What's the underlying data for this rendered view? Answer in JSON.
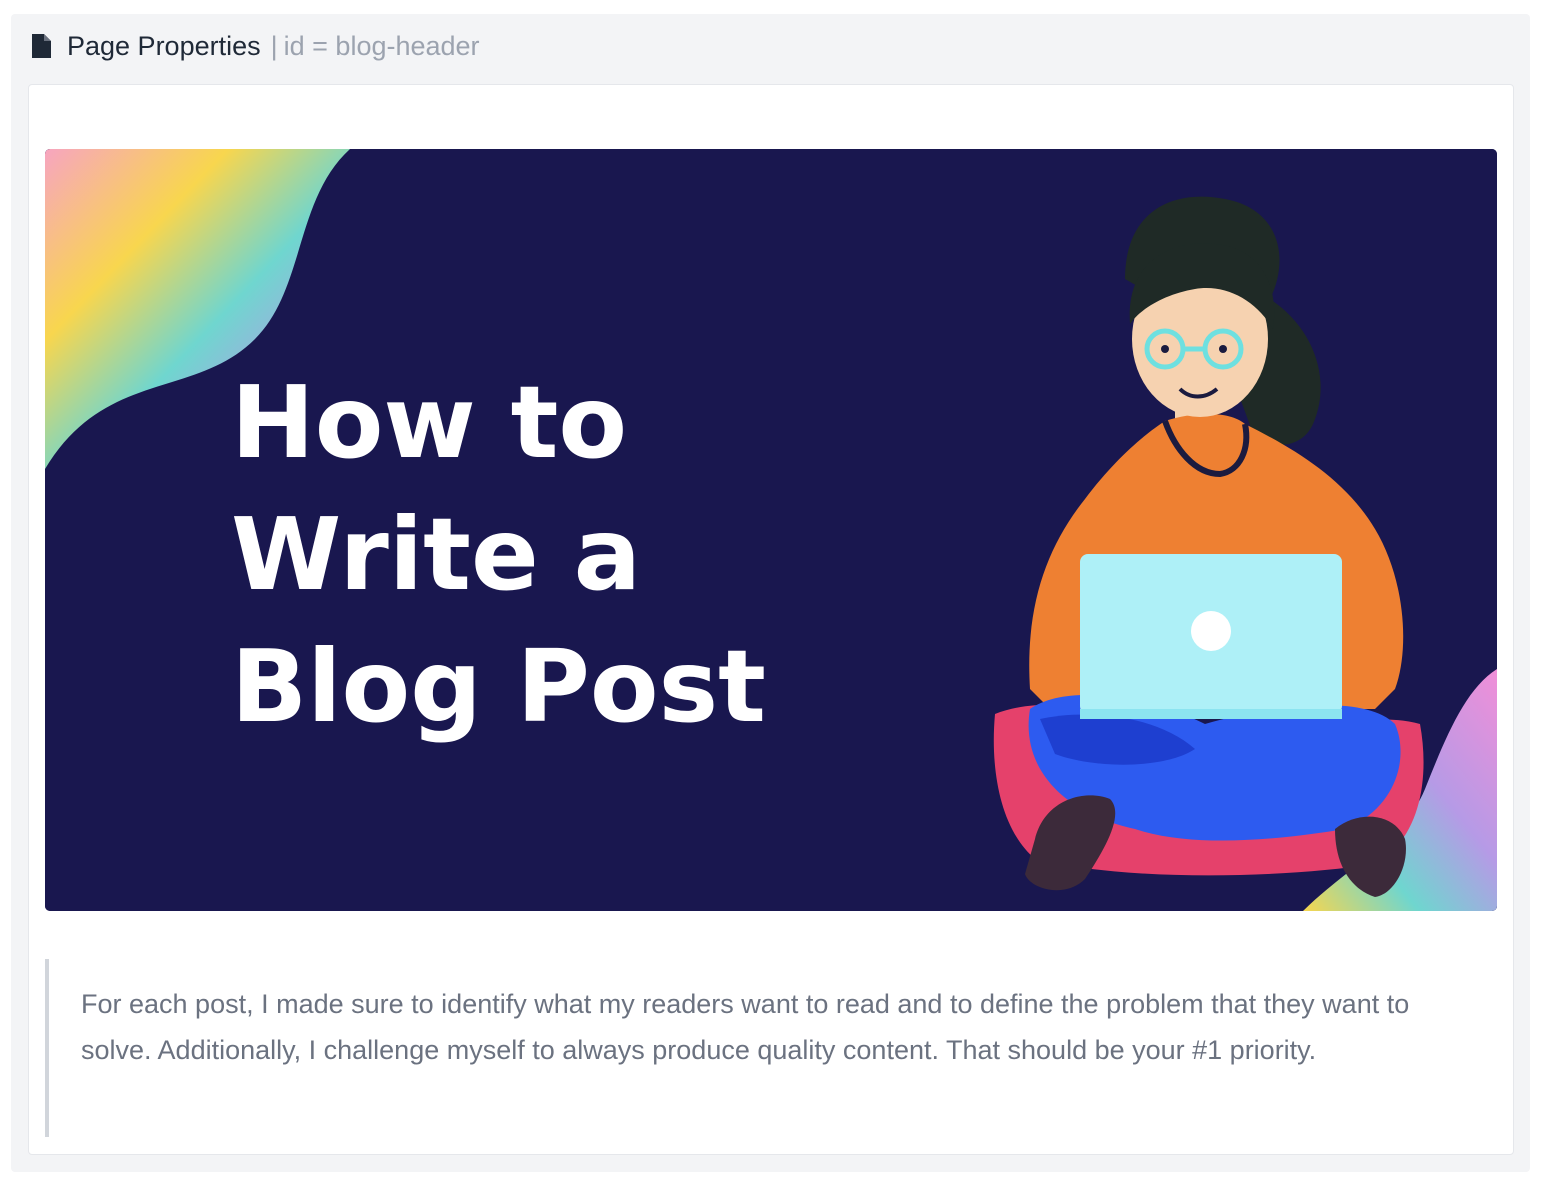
{
  "header": {
    "icon": "document-icon",
    "title": "Page Properties",
    "separator": "|",
    "meta": "id = blog-header"
  },
  "banner": {
    "line1": "How to",
    "line2": "Write a",
    "line3": "Blog Post",
    "colors": {
      "background": "#19174f",
      "text": "#ffffff",
      "sweater": "#ee8032",
      "laptop": "#aef0f7",
      "pants": "#2d5bf0",
      "cushion": "#e5416b",
      "hair": "#1f2a26"
    }
  },
  "quote": {
    "text": "For each post, I made sure to identify what my readers want to read and to define the problem that they want to solve. Additionally, I challenge myself to always produce quality content. That should be your #1 priority."
  }
}
